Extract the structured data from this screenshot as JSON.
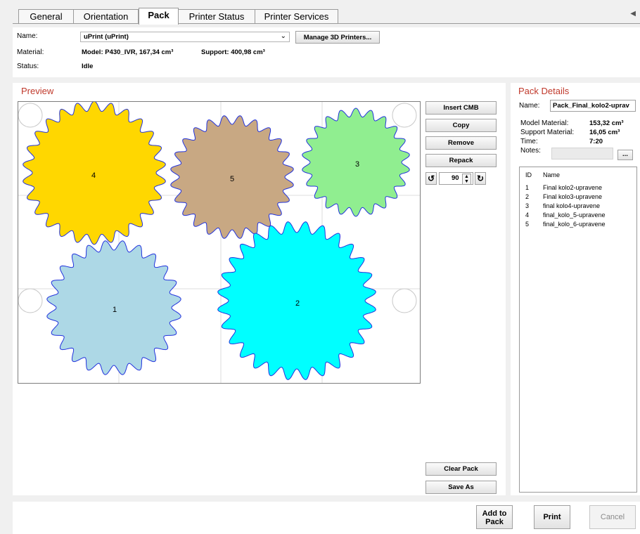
{
  "tabs": [
    {
      "label": "General"
    },
    {
      "label": "Orientation"
    },
    {
      "label": "Pack"
    },
    {
      "label": "Printer Status"
    },
    {
      "label": "Printer Services"
    }
  ],
  "printer": {
    "name_label": "Name:",
    "name_value": "uPrint (uPrint)",
    "manage_button": "Manage 3D Printers...",
    "material_label": "Material:",
    "model_material": "Model: P430_IVR, 167,34 cm³",
    "support_material": "Support: 400,98 cm³",
    "status_label": "Status:",
    "status_value": "Idle"
  },
  "preview": {
    "title": "Preview",
    "parts": [
      {
        "id": "4",
        "color": "#ffd700"
      },
      {
        "id": "5",
        "color": "#c8a883"
      },
      {
        "id": "3",
        "color": "#90ee90"
      },
      {
        "id": "1",
        "color": "#add8e6"
      },
      {
        "id": "2",
        "color": "#00ffff"
      }
    ],
    "buttons": {
      "insert": "Insert CMB",
      "copy": "Copy",
      "remove": "Remove",
      "repack": "Repack",
      "clear": "Clear Pack",
      "save_as": "Save As"
    },
    "rotation_value": "90"
  },
  "details": {
    "title": "Pack Details",
    "name_label": "Name:",
    "name_value": "Pack_Final_kolo2-uprav",
    "model_label": "Model Material:",
    "model_value": "153,32 cm³",
    "support_label": "Support Material:",
    "support_value": "16,05 cm³",
    "time_label": "Time:",
    "time_value": "7:20",
    "notes_label": "Notes:",
    "notes_button": "...",
    "list_headers": {
      "id": "ID",
      "name": "Name"
    },
    "items": [
      {
        "id": "1",
        "name": "Final kolo2-upravene"
      },
      {
        "id": "2",
        "name": "Final kolo3-upravene"
      },
      {
        "id": "3",
        "name": "final kolo4-upravene"
      },
      {
        "id": "4",
        "name": "final_kolo_5-upravene"
      },
      {
        "id": "5",
        "name": "final_kolo_6-upravene"
      }
    ]
  },
  "actions": {
    "add_to_pack": "Add to Pack",
    "print": "Print",
    "cancel": "Cancel"
  }
}
